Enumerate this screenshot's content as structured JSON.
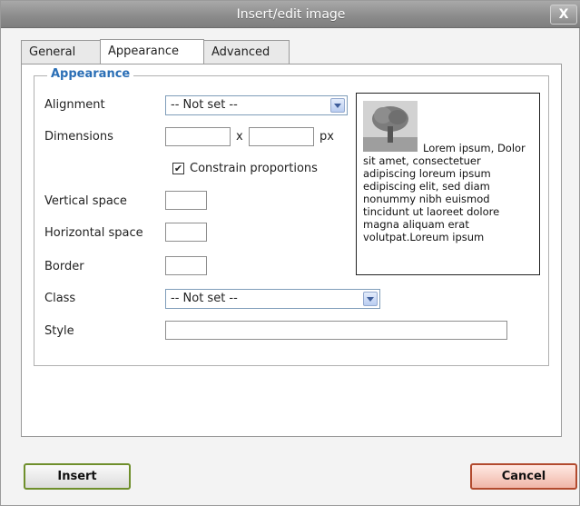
{
  "dialog": {
    "title": "Insert/edit image",
    "close_label": "X"
  },
  "tabs": [
    {
      "label": "General",
      "active": false
    },
    {
      "label": "Appearance",
      "active": true
    },
    {
      "label": "Advanced",
      "active": false
    }
  ],
  "appearance": {
    "legend": "Appearance",
    "alignment": {
      "label": "Alignment",
      "value": "-- Not set --"
    },
    "dimensions": {
      "label": "Dimensions",
      "width": "",
      "height": "",
      "separator": "x",
      "unit": "px"
    },
    "constrain": {
      "label": "Constrain proportions",
      "checked": true,
      "mark": "✔"
    },
    "vertical_space": {
      "label": "Vertical space",
      "value": ""
    },
    "horizontal_space": {
      "label": "Horizontal space",
      "value": ""
    },
    "border": {
      "label": "Border",
      "value": ""
    },
    "class": {
      "label": "Class",
      "value": "-- Not set --"
    },
    "style": {
      "label": "Style",
      "value": ""
    },
    "preview_text": "Lorem ipsum, Dolor sit amet, consectetuer adipiscing loreum ipsum edipiscing elit, sed diam nonummy nibh euismod tincidunt ut laoreet dolore magna aliquam erat volutpat.Loreum ipsum"
  },
  "buttons": {
    "insert": "Insert",
    "cancel": "Cancel"
  },
  "colors": {
    "legend": "#2b6fb6",
    "insert_border": "#6f8f2c",
    "cancel_border": "#b24a2e"
  }
}
